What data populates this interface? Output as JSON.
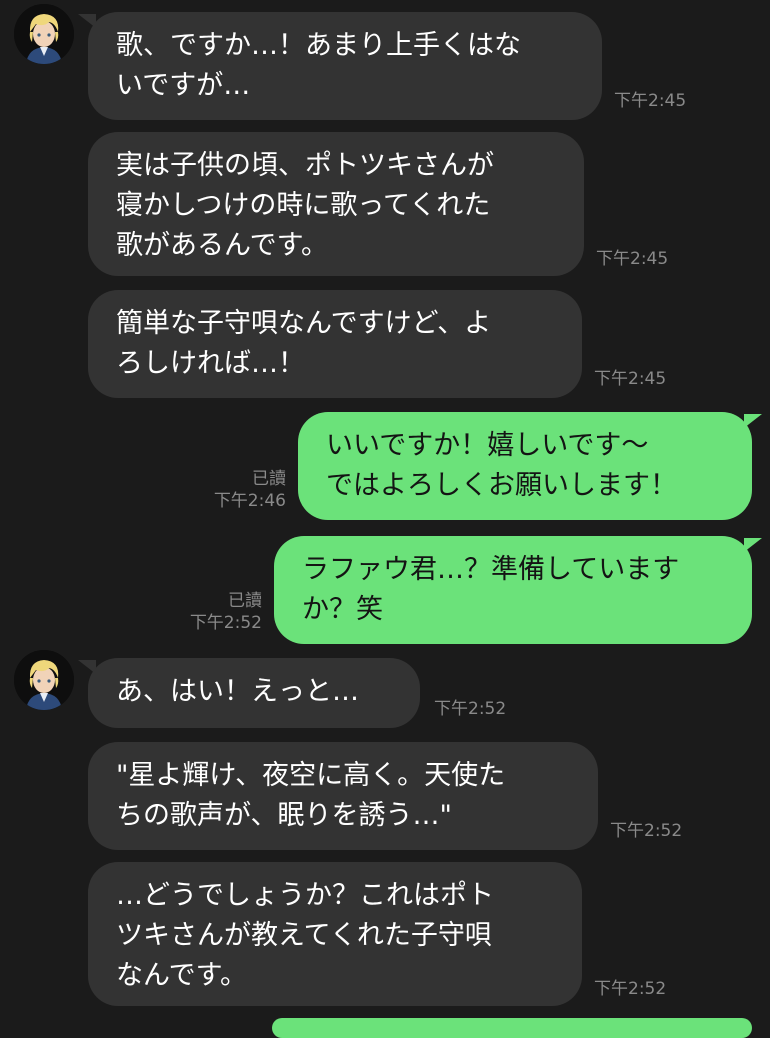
{
  "messages": [
    {
      "from": "other",
      "text": "歌、ですか…！あまり上手くはな\nいですが…",
      "time": "下午2:45"
    },
    {
      "from": "other",
      "text": "実は子供の頃、ポトツキさんが\n寝かしつけの時に歌ってくれた\n歌があるんです。",
      "time": "下午2:45"
    },
    {
      "from": "other",
      "text": "簡単な子守唄なんですけど、よ\nろしければ…！",
      "time": "下午2:45"
    },
    {
      "from": "me",
      "text": "いいですか！嬉しいです〜\nではよろしくお願いします！",
      "read": "已讀",
      "time": "下午2:46"
    },
    {
      "from": "me",
      "text": "ラファウ君…？準備していますか？笑",
      "read": "已讀",
      "time": "下午2:52"
    },
    {
      "from": "other",
      "text": "あ、はい！えっと…",
      "time": "下午2:52"
    },
    {
      "from": "other",
      "text": "\"星よ輝け、夜空に高く。天使た\nちの歌声が、眠りを誘う…\"",
      "time": "下午2:52"
    },
    {
      "from": "other",
      "text": "…どうでしょうか？これはポト\nツキさんが教えてくれた子守唄\nなんです。",
      "time": "下午2:52"
    }
  ],
  "colors": {
    "background": "#1b1b1b",
    "incoming": "#333333",
    "outgoing": "#6be27a",
    "meta": "#8a8a8a"
  },
  "avatar": {
    "icon": "blond-boy-avatar-icon"
  }
}
